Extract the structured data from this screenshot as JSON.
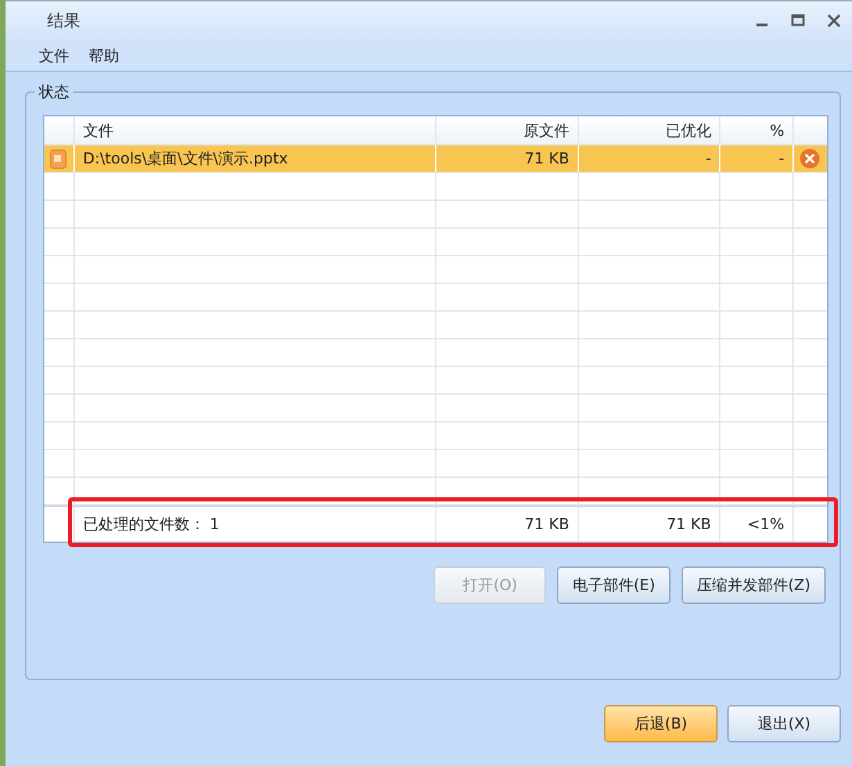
{
  "window": {
    "title": "结果"
  },
  "menu": [
    "文件",
    "帮助"
  ],
  "group": {
    "title": "状态"
  },
  "table": {
    "columns": [
      "文件",
      "原文件",
      "已优化",
      "%"
    ],
    "rows": [
      {
        "file": "D:\\tools\\桌面\\文件\\演示.pptx",
        "original": "71 KB",
        "optimized": "-",
        "percent": "-",
        "selected": true
      }
    ],
    "footer": {
      "label": "已处理的文件数： 1",
      "original": "71 KB",
      "optimized": "71 KB",
      "percent": "<1%"
    }
  },
  "actions": [
    {
      "label": "打开(O)",
      "disabled": true
    },
    {
      "label": "电子部件(E)",
      "disabled": false
    },
    {
      "label": "压缩并发部件(Z)",
      "disabled": false
    }
  ],
  "dialog_buttons": [
    {
      "label": "后退(B)",
      "default": true
    },
    {
      "label": "退出(X)",
      "default": false
    }
  ]
}
